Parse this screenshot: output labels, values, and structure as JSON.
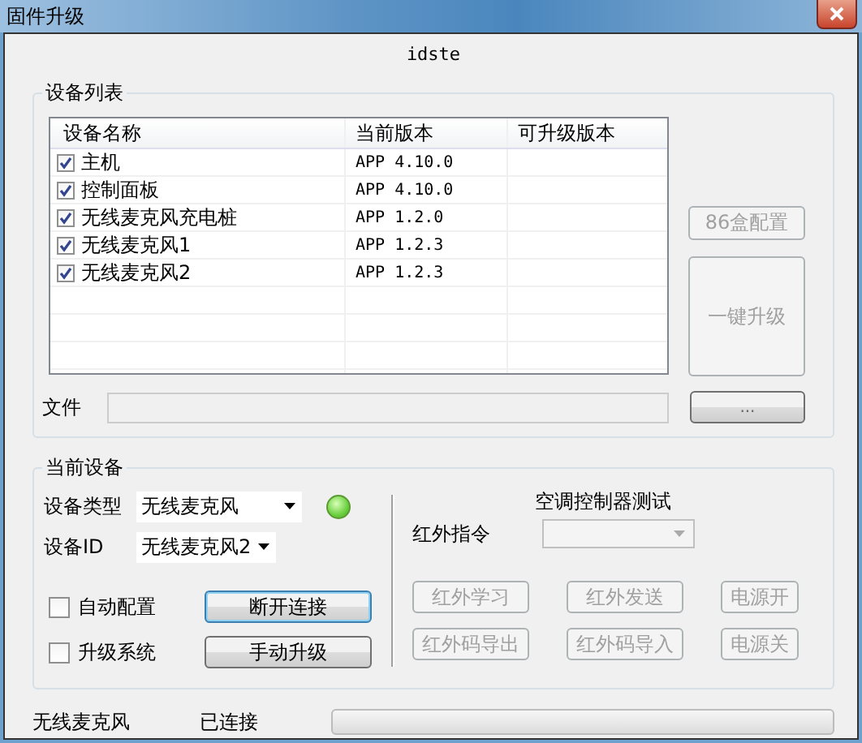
{
  "window": {
    "title": "固件升级"
  },
  "header": "idste",
  "device_list": {
    "legend": "设备列表",
    "columns": [
      "设备名称",
      "当前版本",
      "可升级版本"
    ],
    "rows": [
      {
        "name": "主机",
        "version": "APP 4.10.0",
        "checked": true
      },
      {
        "name": "控制面板",
        "version": "APP 4.10.0",
        "checked": true
      },
      {
        "name": "无线麦克风充电桩",
        "version": "APP 1.2.0",
        "checked": true
      },
      {
        "name": "无线麦克风1",
        "version": "APP 1.2.3",
        "checked": true
      },
      {
        "name": "无线麦克风2",
        "version": "APP 1.2.3",
        "checked": true
      }
    ],
    "buttons": [
      {
        "label": "86盒配置",
        "disabled": true
      },
      {
        "label": "一键升级",
        "disabled": true
      }
    ],
    "file_label": "文件",
    "browse": {
      "label": "...",
      "disabled": false
    }
  },
  "current_device": {
    "legend": "当前设备",
    "fields": [
      {
        "label": "设备类型",
        "value": "无线麦克风"
      },
      {
        "label": "设备ID",
        "value": "无线麦克风2"
      }
    ],
    "connected": true,
    "options": [
      {
        "label": "自动配置",
        "checked": false,
        "button": {
          "label": "断开连接",
          "focused": true
        }
      },
      {
        "label": "升级系统",
        "checked": false,
        "button": {
          "label": "手动升级",
          "focused": false
        }
      }
    ]
  },
  "ac_test": {
    "title": "空调控制器测试",
    "ir_label": "红外指令",
    "ir_disabled": true,
    "buttons": [
      {
        "label": "红外学习",
        "disabled": true
      },
      {
        "label": "红外发送",
        "disabled": true
      },
      {
        "label": "电源开",
        "disabled": true
      },
      {
        "label": "红外码导出",
        "disabled": true
      },
      {
        "label": "红外码导入",
        "disabled": true
      },
      {
        "label": "电源关",
        "disabled": true
      }
    ]
  },
  "status_bar": {
    "device": "无线麦克风",
    "state": "已连接",
    "progress": {
      "level": 0
    }
  }
}
